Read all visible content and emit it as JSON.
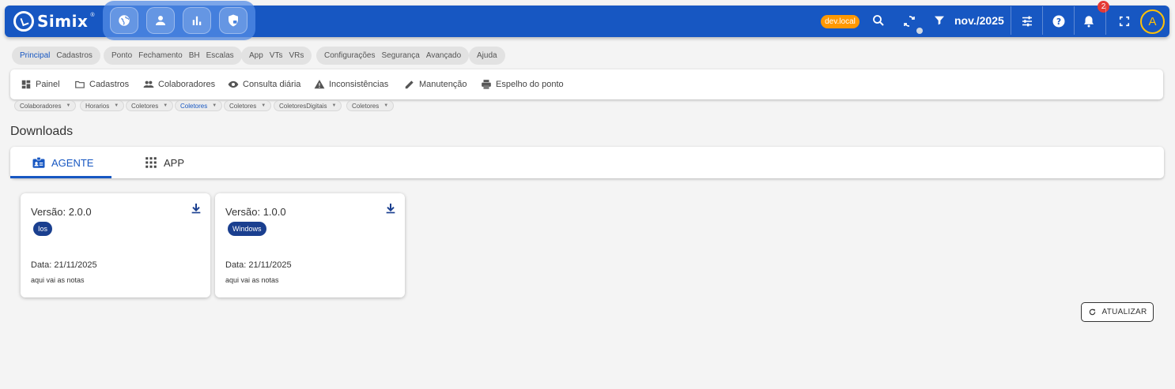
{
  "app": {
    "name": "Simix",
    "reg": "®"
  },
  "topbar": {
    "modules": [
      {
        "name": "globe-icon"
      },
      {
        "name": "person-icon"
      },
      {
        "name": "chart-icon"
      },
      {
        "name": "shield-lock-icon"
      }
    ],
    "env_badge": "dev.local",
    "period": "nov./2025",
    "notification_count": "2",
    "avatar_letter": "A",
    "colors": {
      "primary": "#1757c2",
      "accent": "#ff9800",
      "avatar": "#ffc107",
      "alert": "#e53935"
    }
  },
  "module_chips": [
    {
      "items": [
        "Principal",
        "Cadastros"
      ]
    },
    {
      "items": [
        "Ponto",
        "Fechamento",
        "BH",
        "Escalas"
      ]
    },
    {
      "items": [
        "App",
        "VTs",
        "VRs"
      ]
    },
    {
      "items": [
        "Configurações",
        "Segurança",
        "Avançado"
      ]
    },
    {
      "items": [
        "Ajuda"
      ]
    }
  ],
  "menu": {
    "items": [
      {
        "label": "Painel",
        "icon": "dashboard-icon"
      },
      {
        "label": "Cadastros",
        "icon": "folder-icon"
      },
      {
        "label": "Colaboradores",
        "icon": "people-icon"
      },
      {
        "label": "Consulta diária",
        "icon": "eye-icon"
      },
      {
        "label": "Inconsistências",
        "icon": "warning-icon"
      },
      {
        "label": "Manutenção",
        "icon": "pencil-icon"
      },
      {
        "label": "Espelho do ponto",
        "icon": "printer-icon"
      }
    ]
  },
  "open_tabs": [
    "Colaboradores",
    "Horarios",
    "Coletores",
    "Coletores",
    "Coletores",
    "ColetoresDigitais",
    "Coletores"
  ],
  "page": {
    "title": "Downloads",
    "tabs": [
      {
        "label": "AGENTE",
        "icon": "badge-icon"
      },
      {
        "label": "APP",
        "icon": "apps-grid-icon"
      }
    ],
    "cards": [
      {
        "version": "Versão: 2.0.0",
        "platform": "Ios",
        "date": "Data: 21/11/2025",
        "notes": "aqui vai as notas"
      },
      {
        "version": "Versão: 1.0.0",
        "platform": "Windows",
        "date": "Data: 21/11/2025",
        "notes": "aqui vai as notas"
      }
    ],
    "refresh_label": "ATUALIZAR"
  }
}
